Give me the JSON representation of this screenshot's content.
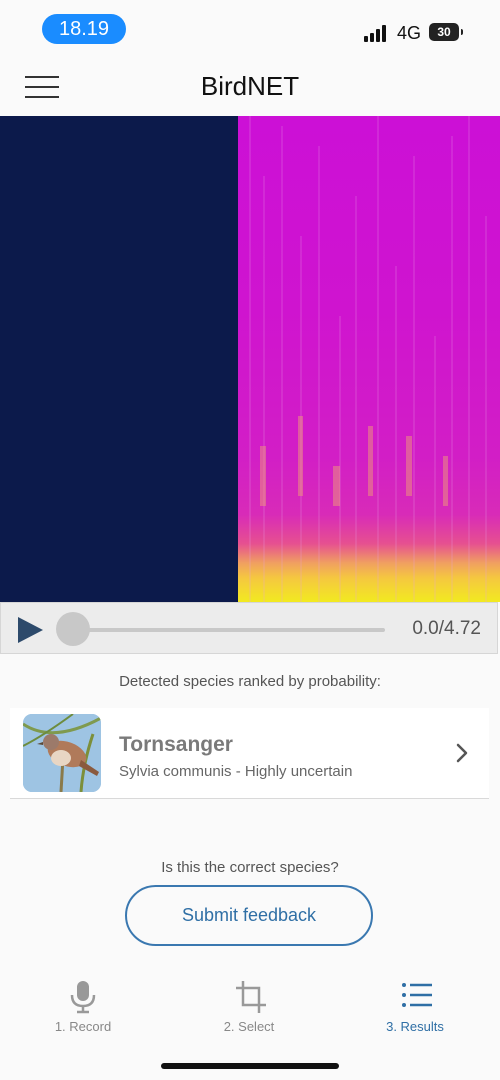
{
  "status_bar": {
    "time": "18.19",
    "network": "4G",
    "battery": "30"
  },
  "app_bar": {
    "title": "BirdNET",
    "menu_icon": "hamburger-menu-icon"
  },
  "spectrogram": {
    "colors": {
      "silence": "#0c1a4b",
      "energy": "#cc10d6",
      "high_energy": "#f2ea20"
    }
  },
  "player": {
    "position_text": "0.0/4.72",
    "progress": 0.0,
    "play_icon": "play-icon"
  },
  "results": {
    "caption": "Detected species ranked by probability:",
    "items": [
      {
        "common_name": "Tornsanger",
        "subtitle": "Sylvia communis - Highly uncertain",
        "icon": "chevron-right-icon"
      }
    ]
  },
  "feedback": {
    "question": "Is this the correct species?",
    "button_label": "Submit feedback"
  },
  "bottom_nav": {
    "items": [
      {
        "label": "1. Record",
        "icon": "microphone-icon",
        "active": false
      },
      {
        "label": "2. Select",
        "icon": "crop-icon",
        "active": false
      },
      {
        "label": "3. Results",
        "icon": "list-icon",
        "active": true
      }
    ]
  },
  "colors": {
    "accent": "#2f6fa5",
    "status_pill": "#1a8cff"
  }
}
